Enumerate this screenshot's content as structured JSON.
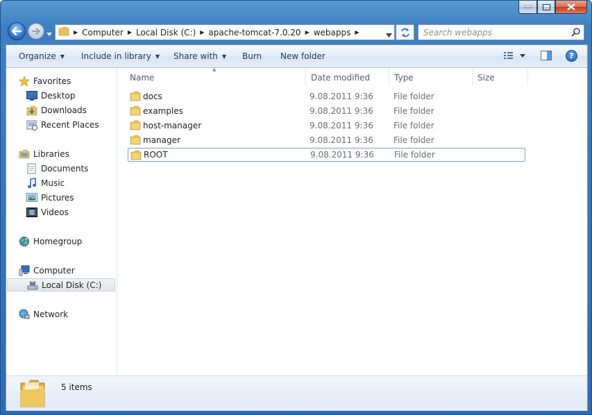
{
  "window": {
    "caption_buttons": [
      "minimize",
      "maximize",
      "close"
    ]
  },
  "address_bar": {
    "breadcrumbs": [
      "Computer",
      "Local Disk (C:)",
      "apache-tomcat-7.0.20",
      "webapps"
    ]
  },
  "search": {
    "placeholder": "Search webapps"
  },
  "toolbar": {
    "organize": "Organize",
    "include_in_library": "Include in library",
    "share_with": "Share with",
    "burn": "Burn",
    "new_folder": "New folder"
  },
  "nav_pane": {
    "favorites": {
      "label": "Favorites",
      "items": [
        "Desktop",
        "Downloads",
        "Recent Places"
      ]
    },
    "libraries": {
      "label": "Libraries",
      "items": [
        "Documents",
        "Music",
        "Pictures",
        "Videos"
      ]
    },
    "homegroup": "Homegroup",
    "computer": {
      "label": "Computer",
      "items": [
        "Local Disk (C:)"
      ]
    },
    "network": "Network"
  },
  "columns": [
    "Name",
    "Date modified",
    "Type",
    "Size"
  ],
  "files": [
    {
      "name": "docs",
      "date": "9.08.2011 9:36",
      "type": "File folder",
      "selected": false
    },
    {
      "name": "examples",
      "date": "9.08.2011 9:36",
      "type": "File folder",
      "selected": false
    },
    {
      "name": "host-manager",
      "date": "9.08.2011 9:36",
      "type": "File folder",
      "selected": false
    },
    {
      "name": "manager",
      "date": "9.08.2011 9:36",
      "type": "File folder",
      "selected": false
    },
    {
      "name": "ROOT",
      "date": "9.08.2011 9:36",
      "type": "File folder",
      "selected": true
    }
  ],
  "status": {
    "item_count": "5 items"
  },
  "colors": {
    "title_bar": "#3f7fc2",
    "folder": "#e8c35a",
    "command_text": "#1e395b"
  }
}
